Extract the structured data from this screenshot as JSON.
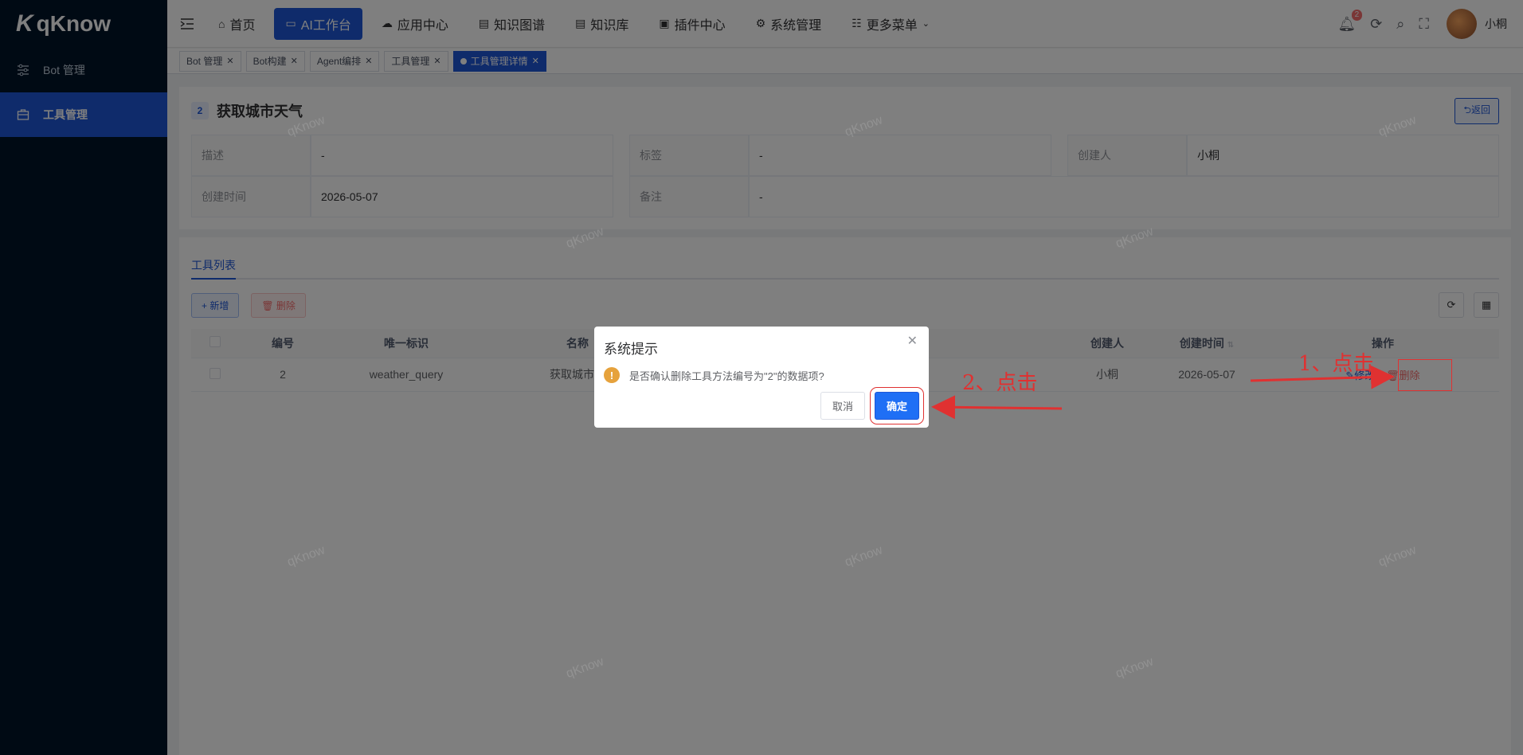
{
  "app": {
    "logo": "qKnow"
  },
  "sidebar": {
    "items": [
      {
        "label": "Bot 管理",
        "active": false
      },
      {
        "label": "工具管理",
        "active": true
      }
    ]
  },
  "topnav": {
    "items": [
      {
        "label": "首页",
        "icon": "home-icon",
        "active": false
      },
      {
        "label": "AI工作台",
        "icon": "monitor-icon",
        "active": true
      },
      {
        "label": "应用中心",
        "icon": "cloud-icon",
        "active": false
      },
      {
        "label": "知识图谱",
        "icon": "book-icon",
        "active": false
      },
      {
        "label": "知识库",
        "icon": "book-icon",
        "active": false
      },
      {
        "label": "插件中心",
        "icon": "bag-icon",
        "active": false
      },
      {
        "label": "系统管理",
        "icon": "gear-icon",
        "active": false
      },
      {
        "label": "更多菜单",
        "icon": "grid-icon",
        "active": false
      }
    ],
    "notification_count": "2",
    "username": "小桐"
  },
  "tags": [
    {
      "label": "Bot 管理",
      "active": false
    },
    {
      "label": "Bot构建",
      "active": false
    },
    {
      "label": "Agent编排",
      "active": false
    },
    {
      "label": "工具管理",
      "active": false
    },
    {
      "label": "工具管理详情",
      "active": true
    }
  ],
  "detail": {
    "id": "2",
    "title": "获取城市天气",
    "back_label": "返回",
    "fields": {
      "desc_label": "描述",
      "desc_value": "-",
      "tag_label": "标签",
      "tag_value": "-",
      "creator_label": "创建人",
      "creator_value": "小桐",
      "created_label": "创建时间",
      "created_value": "2026-05-07",
      "remark_label": "备注",
      "remark_value": "-"
    }
  },
  "list": {
    "tab_label": "工具列表",
    "add_label": "+ 新增",
    "delete_label": "删除",
    "columns": [
      "编号",
      "唯一标识",
      "名称",
      "创建人",
      "创建时间",
      "操作"
    ],
    "rows": [
      {
        "id": "2",
        "key": "weather_query",
        "name": "获取城市天",
        "creator": "小桐",
        "created": "2026-05-07",
        "edit": "修改",
        "delete": "删除"
      }
    ]
  },
  "dialog": {
    "title": "系统提示",
    "message": "是否确认删除工具方法编号为\"2\"的数据项?",
    "cancel": "取消",
    "confirm": "确定"
  },
  "annotations": {
    "step1": "1、点击",
    "step2": "2、点击",
    "color": "#e03131"
  },
  "watermark": "qKnow"
}
